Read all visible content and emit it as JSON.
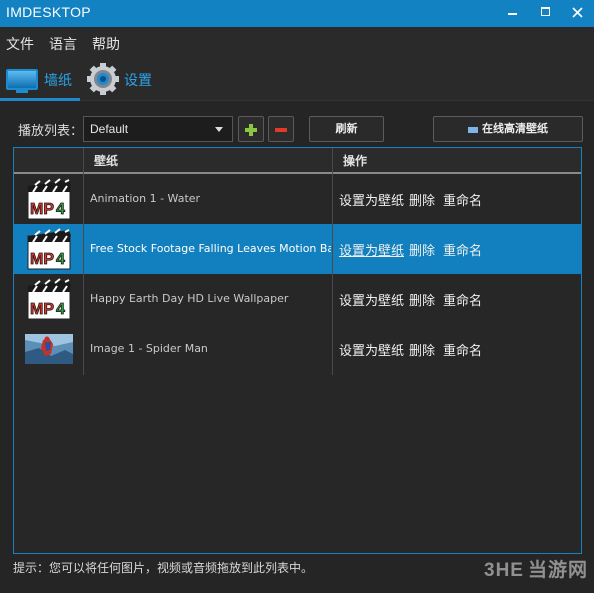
{
  "app": {
    "title": "IMDESKTOP"
  },
  "menu": [
    "文件",
    "语言",
    "帮助"
  ],
  "tabs": [
    {
      "label": "墙纸",
      "icon": "monitor-icon",
      "active": true
    },
    {
      "label": "设置",
      "icon": "gear-icon",
      "active": false
    }
  ],
  "playlist": {
    "label": "播放列表：",
    "selected": "Default",
    "refresh_label": "刷新",
    "online_label": "在线高清壁纸"
  },
  "table": {
    "columns": [
      "壁纸",
      "操作"
    ],
    "rows": [
      {
        "name": "Animation 1 - Water",
        "thumb": "mp4-icon",
        "selected": false
      },
      {
        "name": "Free Stock Footage Falling Leaves Motion Backg",
        "thumb": "mp4-icon",
        "selected": true
      },
      {
        "name": "Happy Earth Day HD Live Wallpaper",
        "thumb": "mp4-icon",
        "selected": false
      },
      {
        "name": "Image 1 - Spider Man",
        "thumb": "image-thumbnail",
        "selected": false
      }
    ],
    "actions": {
      "set": "设置为壁纸",
      "delete": "删除",
      "rename": "重命名"
    }
  },
  "hint": "提示：您可以将任何图片，视频或音频拖放到此列表中。",
  "watermark": {
    "logo": "3HE",
    "text": "当游网"
  },
  "colors": {
    "accent": "#1282c2",
    "selected_row": "#1280bf",
    "add": "#8ac640",
    "remove": "#e23a2a"
  }
}
